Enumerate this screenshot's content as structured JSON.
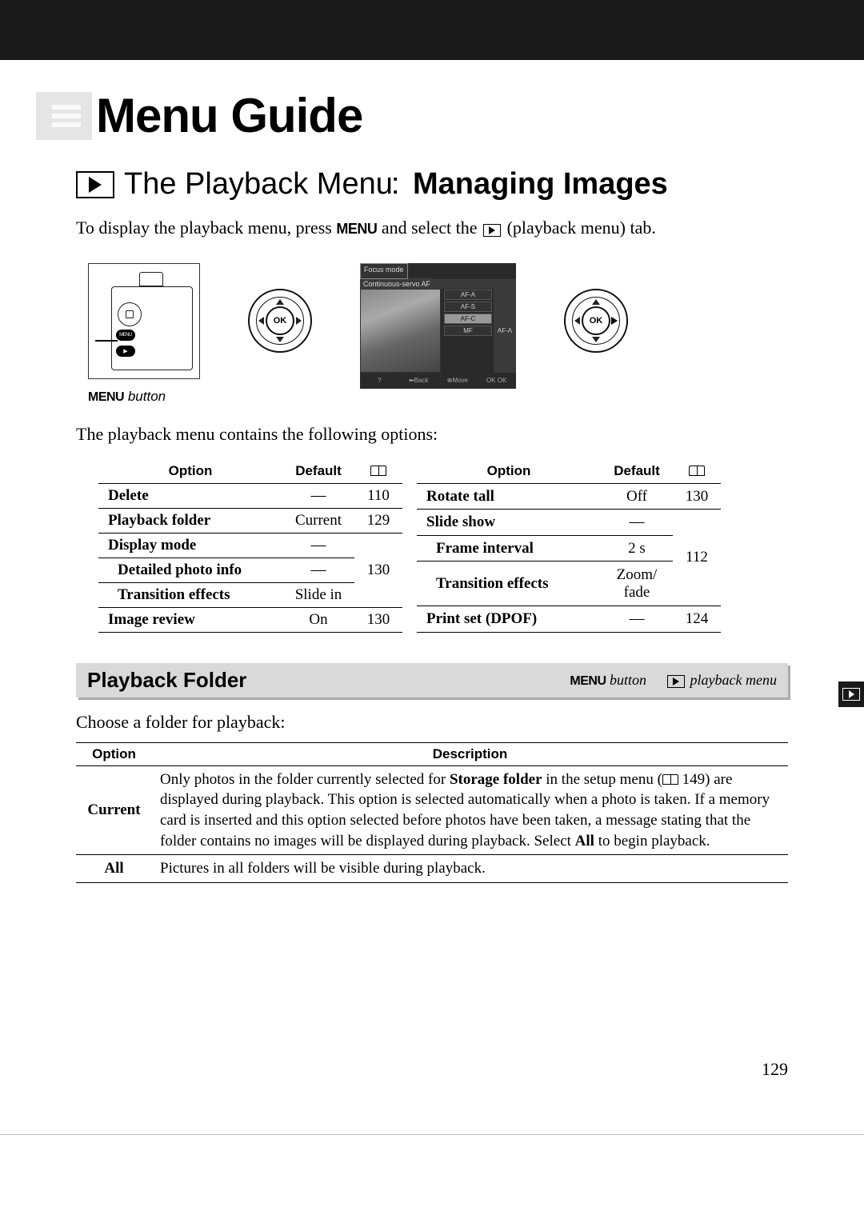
{
  "header": {
    "title": "Menu Guide"
  },
  "section": {
    "title_part1": "The Playback Menu",
    "title_part2": "Managing Images",
    "intro_prefix": "To display the playback menu, press ",
    "intro_menu": "MENU",
    "intro_mid": " and select the ",
    "intro_suffix": " (playback menu) tab."
  },
  "caption": {
    "menu": "MENU",
    "text": " button"
  },
  "intro2": "The playback menu contains the following options:",
  "table_headers": {
    "option": "Option",
    "default": "Default",
    "page_icon": "book"
  },
  "left_options": [
    {
      "option": "Delete",
      "default": "—",
      "page": "110",
      "indent": false
    },
    {
      "option": "Playback folder",
      "default": "Current",
      "page": "129",
      "indent": false
    },
    {
      "option": "Display mode",
      "default": "—",
      "page": "",
      "indent": false
    },
    {
      "option": "Detailed photo info",
      "default": "—",
      "page": "130",
      "indent": true
    },
    {
      "option": "Transition effects",
      "default": "Slide in",
      "page": "",
      "indent": true
    },
    {
      "option": "Image review",
      "default": "On",
      "page": "130",
      "indent": false
    }
  ],
  "right_options": [
    {
      "option": "Rotate tall",
      "default": "Off",
      "page": "130",
      "indent": false
    },
    {
      "option": "Slide show",
      "default": "—",
      "page": "",
      "indent": false
    },
    {
      "option": "Frame interval",
      "default": "2 s",
      "page": "112",
      "indent": true
    },
    {
      "option": "Transition effects",
      "default": "Zoom/\nfade",
      "page": "",
      "indent": true
    },
    {
      "option": "Print set (DPOF)",
      "default": "—",
      "page": "124",
      "indent": false
    }
  ],
  "subsection": {
    "title": "Playback Folder",
    "meta_menu": "MENU",
    "meta_button": " button",
    "meta_playback": " playback menu"
  },
  "intro3": "Choose a folder for playback:",
  "desc_headers": {
    "option": "Option",
    "description": "Description"
  },
  "desc_rows": [
    {
      "option": "Current",
      "desc_pre": "Only photos in the folder currently selected for ",
      "desc_bold1": "Storage folder",
      "desc_mid1": "  in the setup menu (",
      "desc_pageref": " 149) are displayed during playback.  This option is selected automatically when a photo is taken.  If a memory card is inserted and this option selected before photos have been taken, a message stating that the folder contains no images will be displayed during playback.  Select ",
      "desc_bold2": "All",
      "desc_end": " to begin playback."
    },
    {
      "option": "All",
      "desc": "Pictures in all folders will be visible during playback."
    }
  ],
  "lcd": {
    "tab": "Focus mode",
    "header": "Continuous-servo AF",
    "btn1": "AF-A",
    "btn2": "AF-S",
    "btn3": "AF-C",
    "btn4": "MF",
    "side": "AF-A",
    "bottom_help": "?",
    "bottom_back": "⬅Back",
    "bottom_move": "⊕Move",
    "bottom_ok": "OK OK"
  },
  "page_number": "129"
}
